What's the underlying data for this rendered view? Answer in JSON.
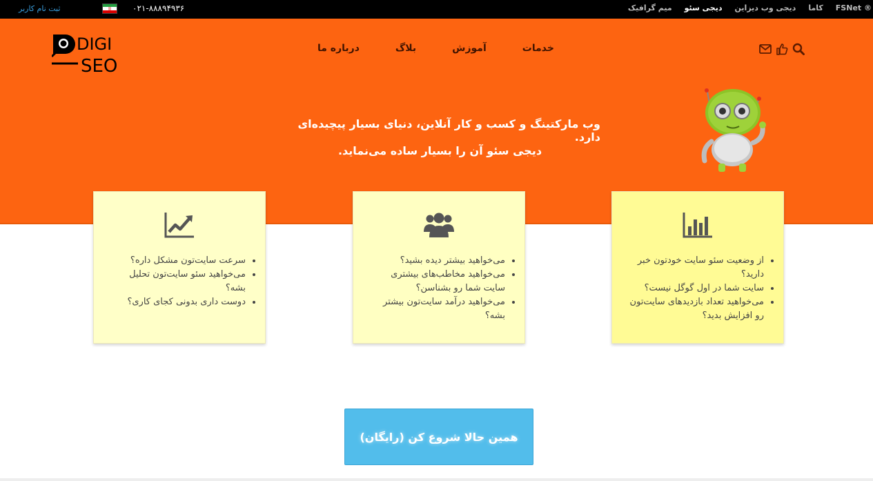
{
  "topbar": {
    "register": "ثبت نام کاربر",
    "phone": "۰۲۱-۸۸۸۹۴۹۳۶",
    "links": [
      "FSNet ®",
      "کاما",
      "دیجی وب دیزاین",
      "دیجی سئو",
      "میم گرافیک"
    ],
    "active_link": "دیجی سئو"
  },
  "logo": {
    "line1": "DIGI",
    "line2": "SEO"
  },
  "nav": {
    "items": [
      "خدمات",
      "آموزش",
      "بلاگ",
      "درباره ما"
    ],
    "icons": [
      "search-icon",
      "thumbs-up-icon",
      "mail-icon"
    ]
  },
  "hero": {
    "line1": "وب مارکتینگ و کسب و کار آنلاین، دنیای بسیار پیچیده‌ای دارد.",
    "line2": "دیجی سئو آن را بسیار ساده می‌نماید."
  },
  "cards": [
    {
      "icon": "bar-chart-icon",
      "items": [
        "از وضعیت سئو سایت خودتون خبر دارید؟",
        "سایت شما در اول گوگل نیست؟",
        "می‌خواهید تعداد بازدیدهای سایت‌تون رو افزایش بدید؟"
      ]
    },
    {
      "icon": "users-icon",
      "items": [
        "می‌خواهید بیشتر دیده بشید؟",
        "می‌خواهید مخاطب‌های بیشتری سایت شما رو بشناسن؟",
        "می‌خواهید درآمد سایت‌تون بیشتر بشه؟"
      ]
    },
    {
      "icon": "trend-up-icon",
      "items": [
        "سرعت سایت‌تون مشکل داره؟",
        "می‌خواهید سئو سایت‌تون تحلیل بشه؟",
        "دوست داری بدونی کجای کاری؟"
      ]
    }
  ],
  "cta": {
    "label": "همین حالا شروع کن (رایگان)"
  },
  "colors": {
    "orange": "#fd6411",
    "black_bar": "#000000",
    "cta_blue": "#52bdeb",
    "card_yellow": "#fffb95",
    "card_pale": "#ffffc8"
  }
}
